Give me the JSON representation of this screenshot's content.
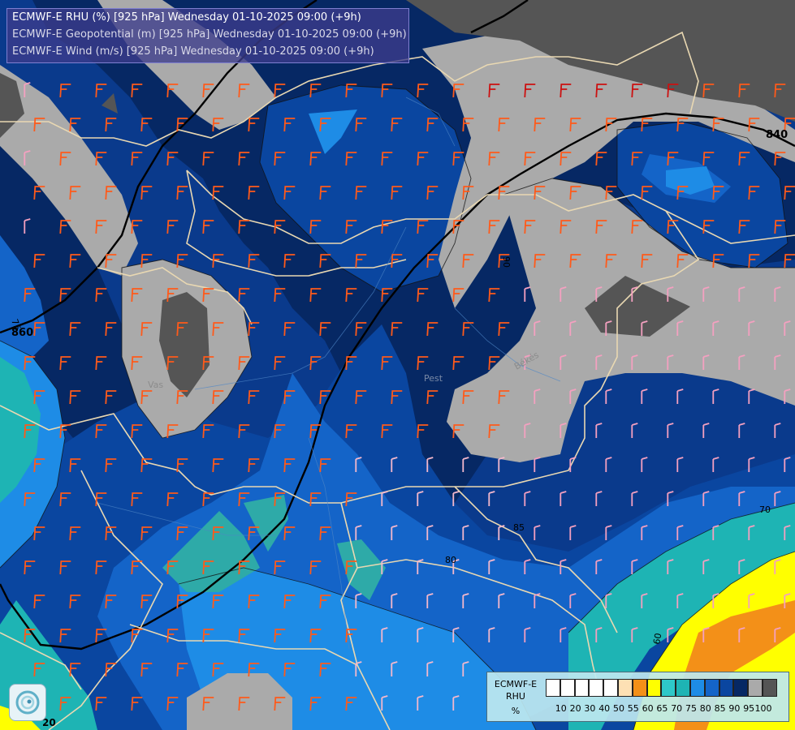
{
  "title_lines": [
    "ECMWF-E RHU (%) [925 hPa] Wednesday 01-10-2025 09:00 (+9h)",
    "ECMWF-E Geopotential (m) [925 hPa] Wednesday 01-10-2025 09:00 (+9h)",
    "ECMWF-E Wind (m/s) [925 hPa] Wednesday 01-10-2025 09:00 (+9h)"
  ],
  "legend": {
    "model": "ECMWF-E",
    "field": "RHU",
    "unit": "%",
    "swatch_colors": [
      "#ffffff",
      "#ffffff",
      "#ffffff",
      "#ffffff",
      "#ffffff",
      "#fde0b4",
      "#f39018",
      "#ffff00",
      "#2ec8c8",
      "#1eb4b4",
      "#1e8ce6",
      "#1464c8",
      "#0a46a0",
      "#062864",
      "#aaaaaa",
      "#555555"
    ],
    "tick_labels": [
      "10",
      "20",
      "30",
      "40",
      "50",
      "55",
      "60",
      "65",
      "70",
      "75",
      "80",
      "85",
      "90",
      "95",
      "100"
    ]
  },
  "geopotential_labels": [
    "840",
    "860"
  ],
  "rhu_contour_labels": [
    "85",
    "90",
    "80",
    "70",
    "60",
    "75",
    "20"
  ],
  "place_labels": [
    "Pest",
    "Békés",
    "Vas"
  ]
}
